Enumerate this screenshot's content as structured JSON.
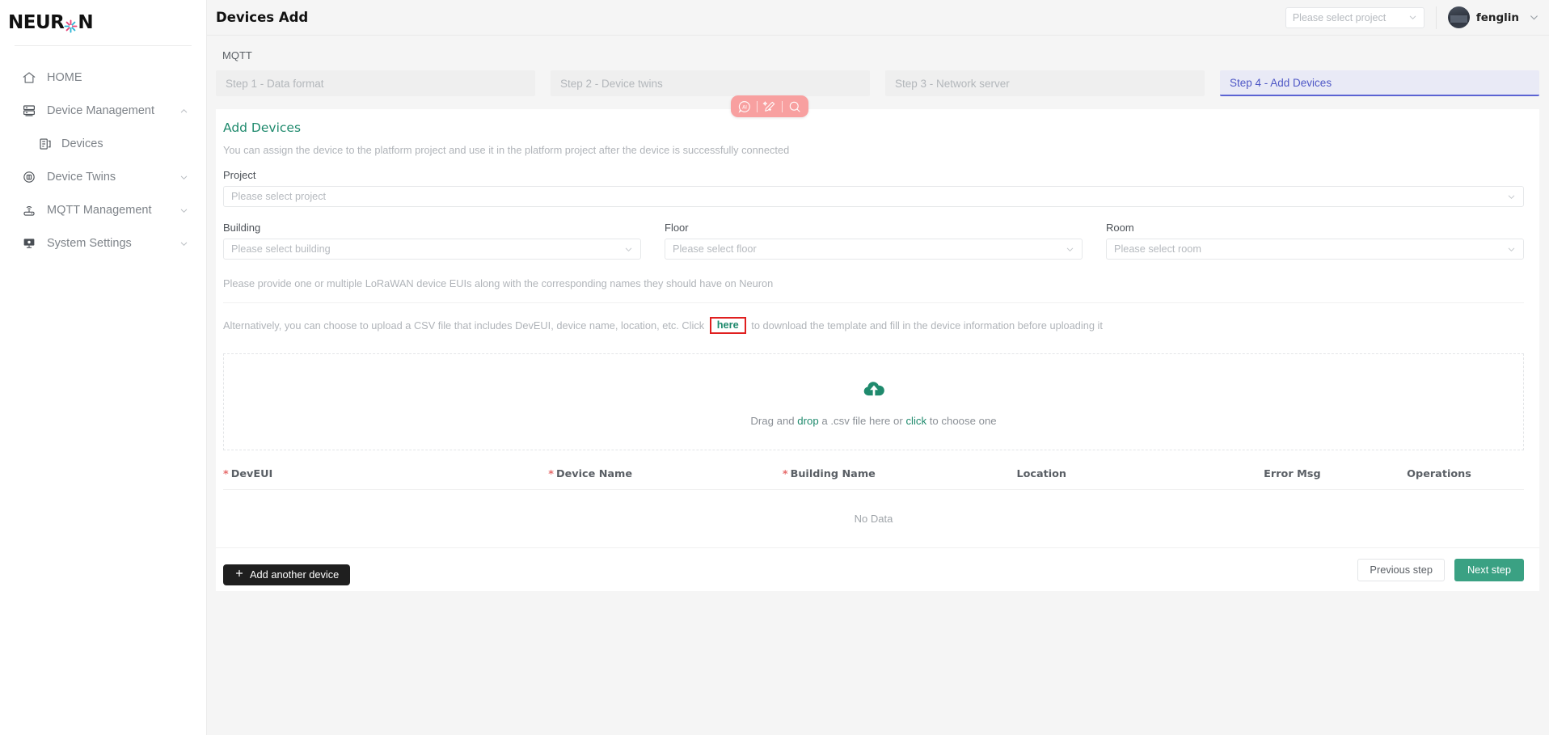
{
  "brand": {
    "name_part1": "NEUR",
    "name_part2": "N",
    "star_icon": "asterisk-star-icon"
  },
  "sidebar": {
    "items": [
      {
        "label": "HOME",
        "icon": "home-icon",
        "has_chevron": false,
        "sub": false
      },
      {
        "label": "Device Management",
        "icon": "server-rack-icon",
        "has_chevron": true,
        "chevron": "chevron-up-icon",
        "sub": false
      },
      {
        "label": "Devices",
        "icon": "device-list-icon",
        "has_chevron": false,
        "sub": true
      },
      {
        "label": "Device Twins",
        "icon": "twin-circle-icon",
        "has_chevron": true,
        "chevron": "chevron-down-icon",
        "sub": false
      },
      {
        "label": "MQTT Management",
        "icon": "router-icon",
        "has_chevron": true,
        "chevron": "chevron-down-icon",
        "sub": false
      },
      {
        "label": "System Settings",
        "icon": "monitor-settings-icon",
        "has_chevron": true,
        "chevron": "chevron-down-icon",
        "sub": false
      }
    ]
  },
  "header": {
    "title": "Devices Add",
    "project_select_placeholder": "Please select project",
    "project_select_value": "",
    "user_name": "fenglin",
    "avatar_icon": "user-avatar",
    "chevron_icon": "chevron-down-icon"
  },
  "float_toolbar": {
    "background": "#f8a0a0",
    "icons": [
      {
        "name": "ai-icon",
        "glyph": "AI"
      },
      {
        "name": "magic-pen-icon",
        "glyph": "pen"
      },
      {
        "name": "search-icon",
        "glyph": "search"
      }
    ]
  },
  "breadcrumb": "MQTT",
  "steps": [
    {
      "label": "Step 1 - Data format",
      "active": false
    },
    {
      "label": "Step 2 - Device twins",
      "active": false
    },
    {
      "label": "Step 3 - Network server",
      "active": false
    },
    {
      "label": "Step 4 - Add Devices",
      "active": true
    }
  ],
  "section": {
    "title": "Add Devices",
    "subtitle": "You can assign the device to the platform project and use it in the platform project after the device is successfully connected"
  },
  "form": {
    "project": {
      "label": "Project",
      "placeholder": "Please select project",
      "value": ""
    },
    "building": {
      "label": "Building",
      "placeholder": "Please select building",
      "value": ""
    },
    "floor": {
      "label": "Floor",
      "placeholder": "Please select floor",
      "value": ""
    },
    "room": {
      "label": "Room",
      "placeholder": "Please select room",
      "value": ""
    }
  },
  "hints": {
    "line1": "Please provide one or multiple LoRaWAN device EUIs along with the corresponding names they should have on Neuron",
    "line2_before": "Alternatively, you can choose to upload a CSV file that includes DevEUI, device name, location, etc. Click ",
    "line2_link": "here",
    "line2_after": " to download the template and fill in the device information before uploading it",
    "link_color": "#1f8a6d",
    "annotation_color": "#e01f1f"
  },
  "dropzone": {
    "icon": "cloud-upload-icon",
    "icon_color": "#1f8a6d",
    "text_before": "Drag and ",
    "text_link1": "drop",
    "text_middle": " a .csv file here or ",
    "text_link2": "click",
    "text_after": " to choose one"
  },
  "table": {
    "columns": [
      {
        "label": "DevEUI",
        "required": true
      },
      {
        "label": "Device Name",
        "required": true
      },
      {
        "label": "Building Name",
        "required": true
      },
      {
        "label": "Location",
        "required": false
      },
      {
        "label": "Error Msg",
        "required": false
      },
      {
        "label": "Operations",
        "required": false
      }
    ],
    "rows": [],
    "empty_text": "No Data"
  },
  "buttons": {
    "add_another": "Add another device",
    "add_another_icon": "plus-icon",
    "previous": "Previous step",
    "next": "Next step",
    "next_color": "#3aa183"
  }
}
